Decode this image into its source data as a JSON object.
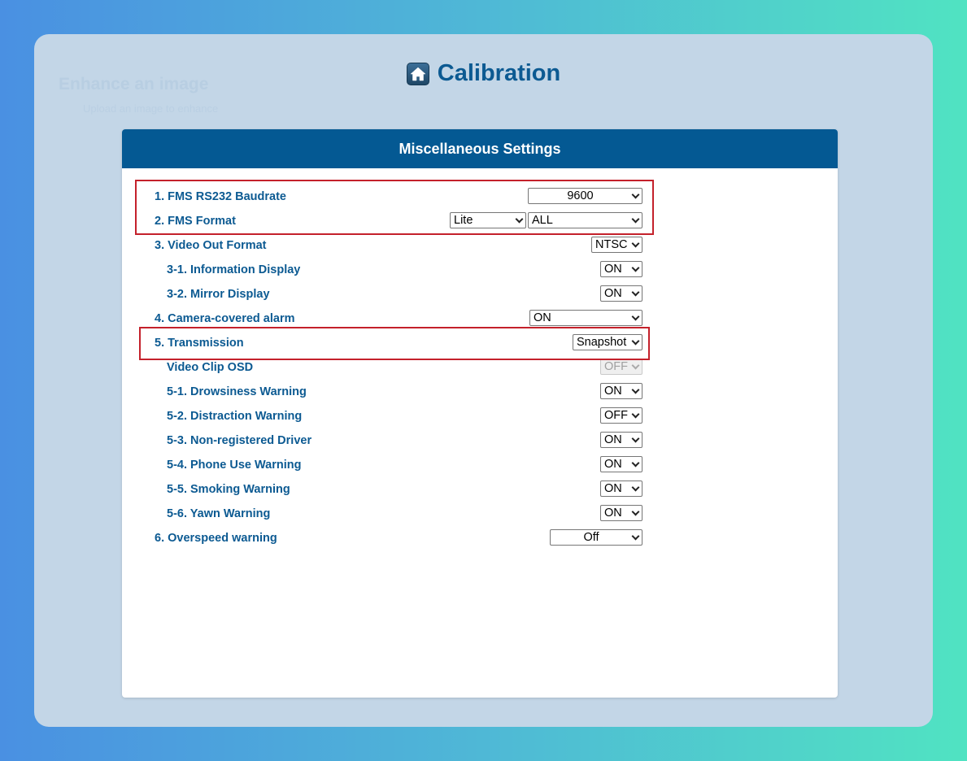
{
  "page": {
    "title": "Calibration",
    "home_icon": "home-icon",
    "ghost_title": "Enhance an image",
    "ghost_subtitle": "Upload an image to enhance"
  },
  "panel": {
    "header": "Miscellaneous Settings",
    "rows": [
      {
        "label": "1. FMS RS232 Baudrate",
        "values": [
          "9600"
        ]
      },
      {
        "label": "2. FMS Format",
        "values": [
          "Lite",
          "ALL"
        ]
      },
      {
        "label": "3. Video Out Format",
        "values": [
          "NTSC"
        ]
      },
      {
        "label": "3-1. Information Display",
        "values": [
          "ON"
        ]
      },
      {
        "label": "3-2. Mirror Display",
        "values": [
          "ON"
        ]
      },
      {
        "label": "4. Camera-covered alarm",
        "values": [
          "ON"
        ]
      },
      {
        "label": "5. Transmission",
        "values": [
          "Snapshot"
        ]
      },
      {
        "label": "Video Clip OSD",
        "values": [
          "OFF"
        ],
        "disabled": true
      },
      {
        "label": "5-1. Drowsiness Warning",
        "values": [
          "ON"
        ]
      },
      {
        "label": "5-2. Distraction Warning",
        "values": [
          "OFF"
        ]
      },
      {
        "label": "5-3. Non-registered Driver",
        "values": [
          "ON"
        ]
      },
      {
        "label": "5-4. Phone Use Warning",
        "values": [
          "ON"
        ]
      },
      {
        "label": "5-5. Smoking Warning",
        "values": [
          "ON"
        ]
      },
      {
        "label": "5-6. Yawn Warning",
        "values": [
          "ON"
        ]
      },
      {
        "label": "6. Overspeed warning",
        "values": [
          "Off"
        ]
      }
    ]
  },
  "colors": {
    "accent": "#045993",
    "label": "#0c5a92",
    "highlight": "#c4212b"
  }
}
